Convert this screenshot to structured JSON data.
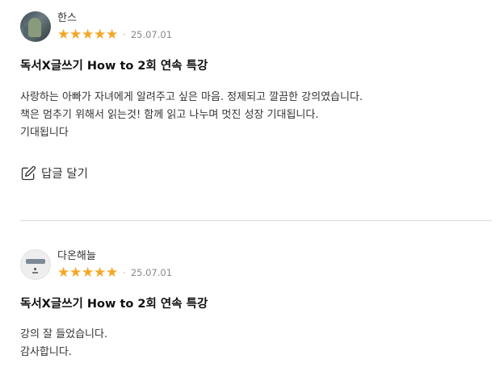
{
  "reviews": [
    {
      "author": "한스",
      "rating": 5,
      "date": "25.07.01",
      "title": "독서X글쓰기 How to 2회 연속 특강",
      "body_lines": [
        "사랑하는 아빠가 자녀에게 알려주고 싶은 마음. 정제되고 깔끔한 강의였습니다.",
        "책은 멈추기 위해서 읽는것! 함께 읽고 나누며 멋진 성장 기대됩니다.",
        "기대됩니다"
      ],
      "reply_label": "답글 달기"
    },
    {
      "author": "다온해늘",
      "rating": 5,
      "date": "25.07.01",
      "title": "독서X글쓰기 How to 2회 연속 특강",
      "body_lines": [
        "강의 잘 들었습니다.",
        "감사합니다."
      ]
    }
  ],
  "colors": {
    "star": "#f5a623",
    "divider": "#d9d9d9"
  },
  "icons": {
    "star": "star-icon",
    "reply": "edit-pencil-icon",
    "separator": "dot-separator"
  }
}
